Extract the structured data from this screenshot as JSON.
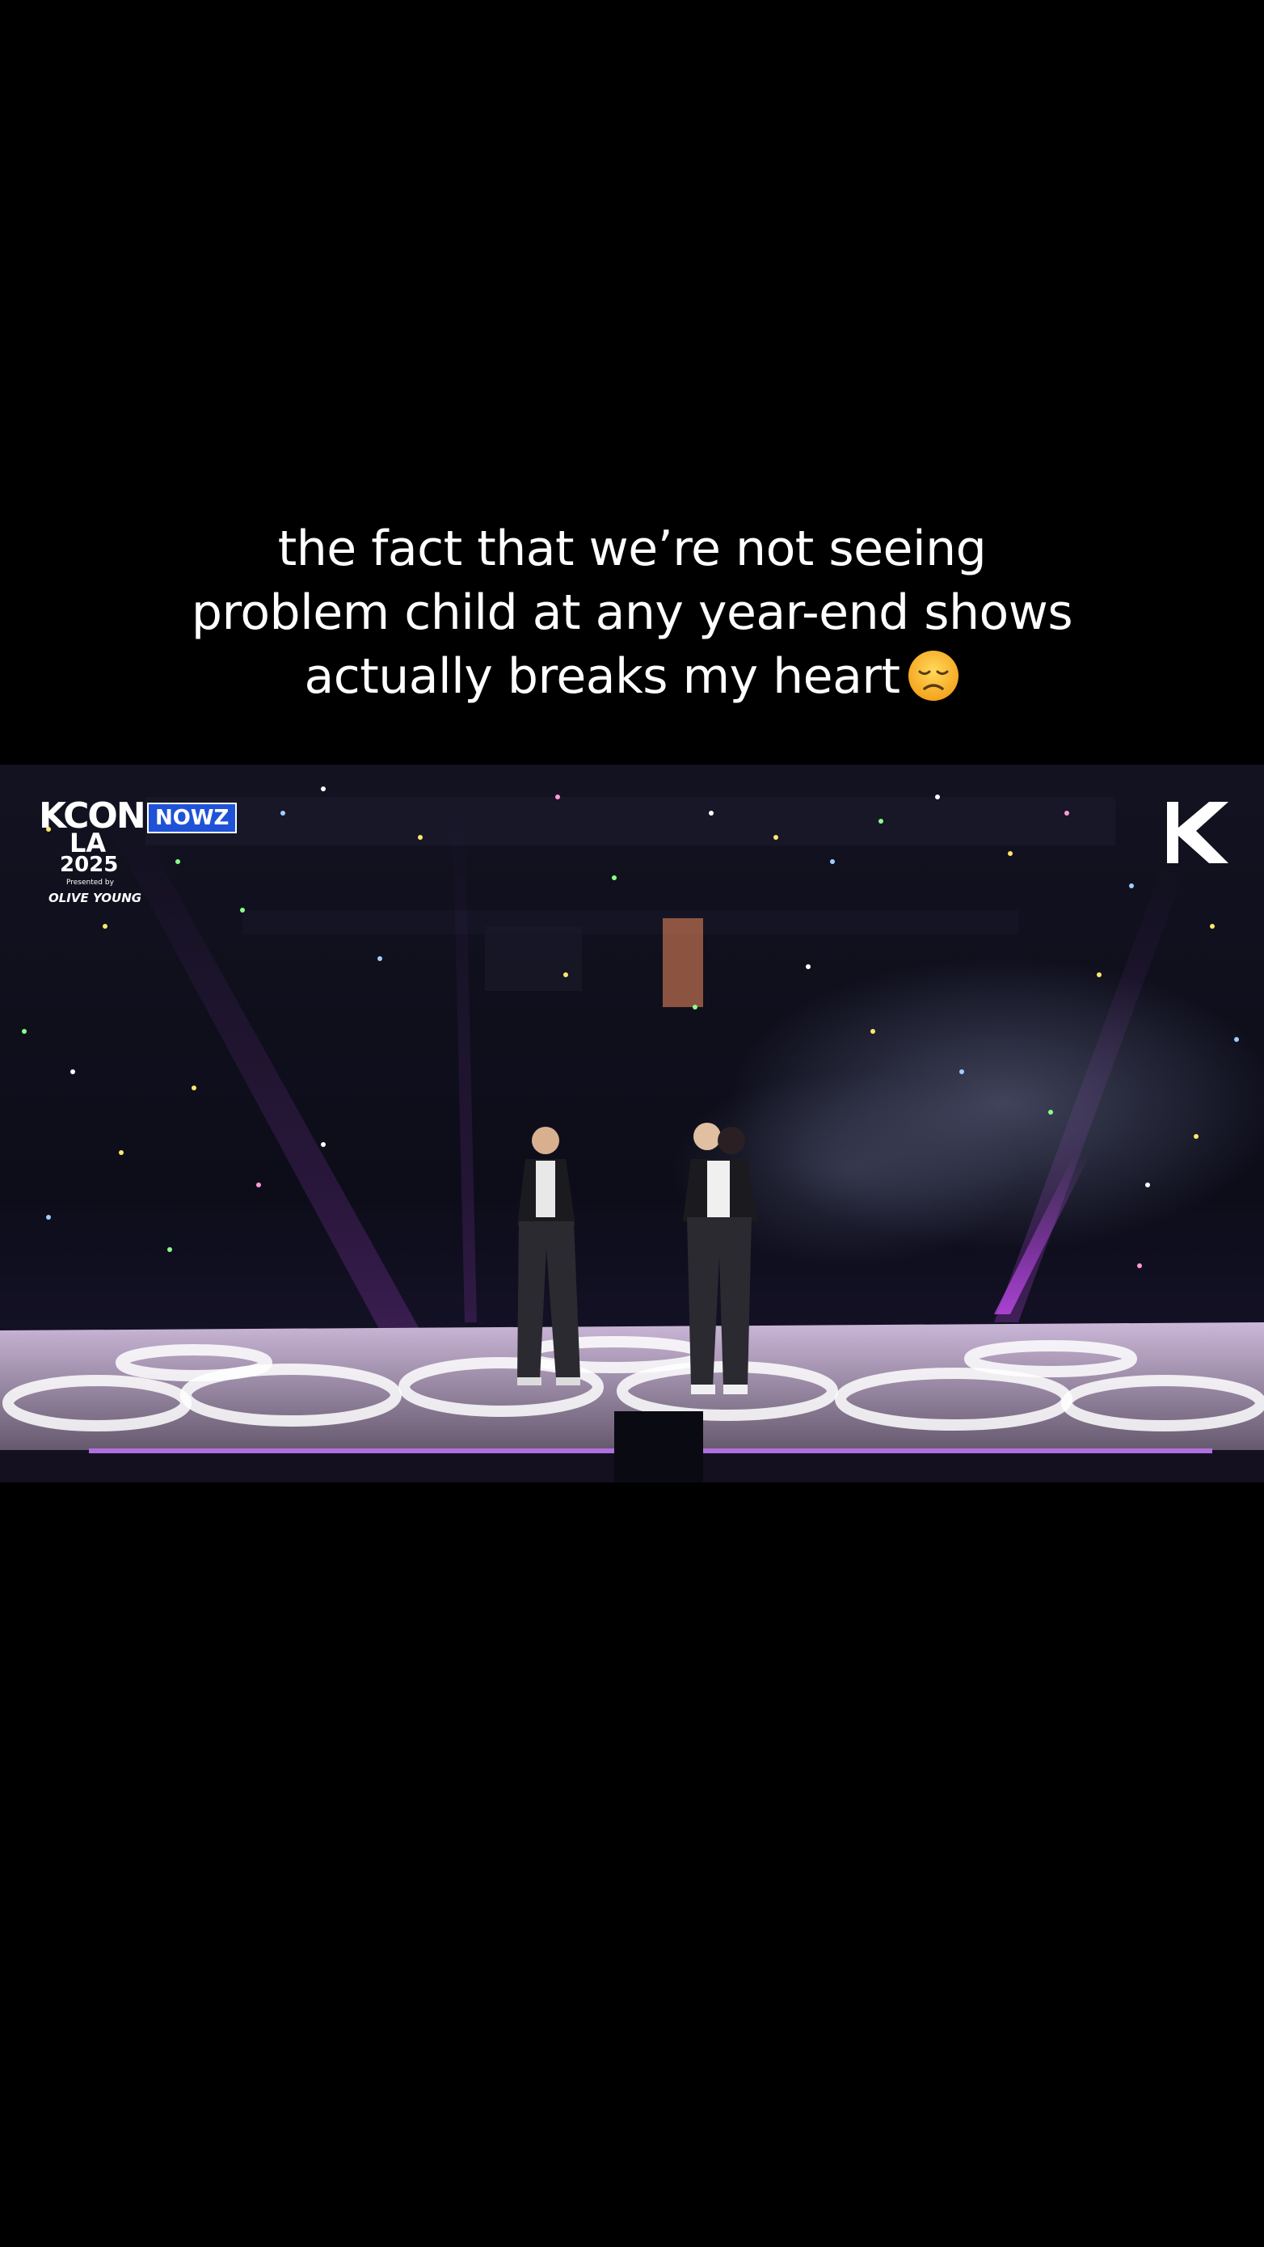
{
  "post": {
    "caption_lines": [
      "the fact that we’re not seeing",
      "problem child at any year-end shows",
      "actually breaks my heart"
    ],
    "caption_emoji": "disappointed-face-emoji"
  },
  "video": {
    "overlay_logo": {
      "word": "KCON",
      "city": "LA",
      "year": "2025",
      "presented_by": "Presented by",
      "sponsor": "OLIVE YOUNG"
    },
    "artist_badge": "NOWZ",
    "corner_logo": "kcon-k-logo-icon"
  },
  "colors": {
    "background": "#000000",
    "caption_text": "#ffffff",
    "badge": "#1f52d6",
    "stage_light": "#c040e0"
  }
}
